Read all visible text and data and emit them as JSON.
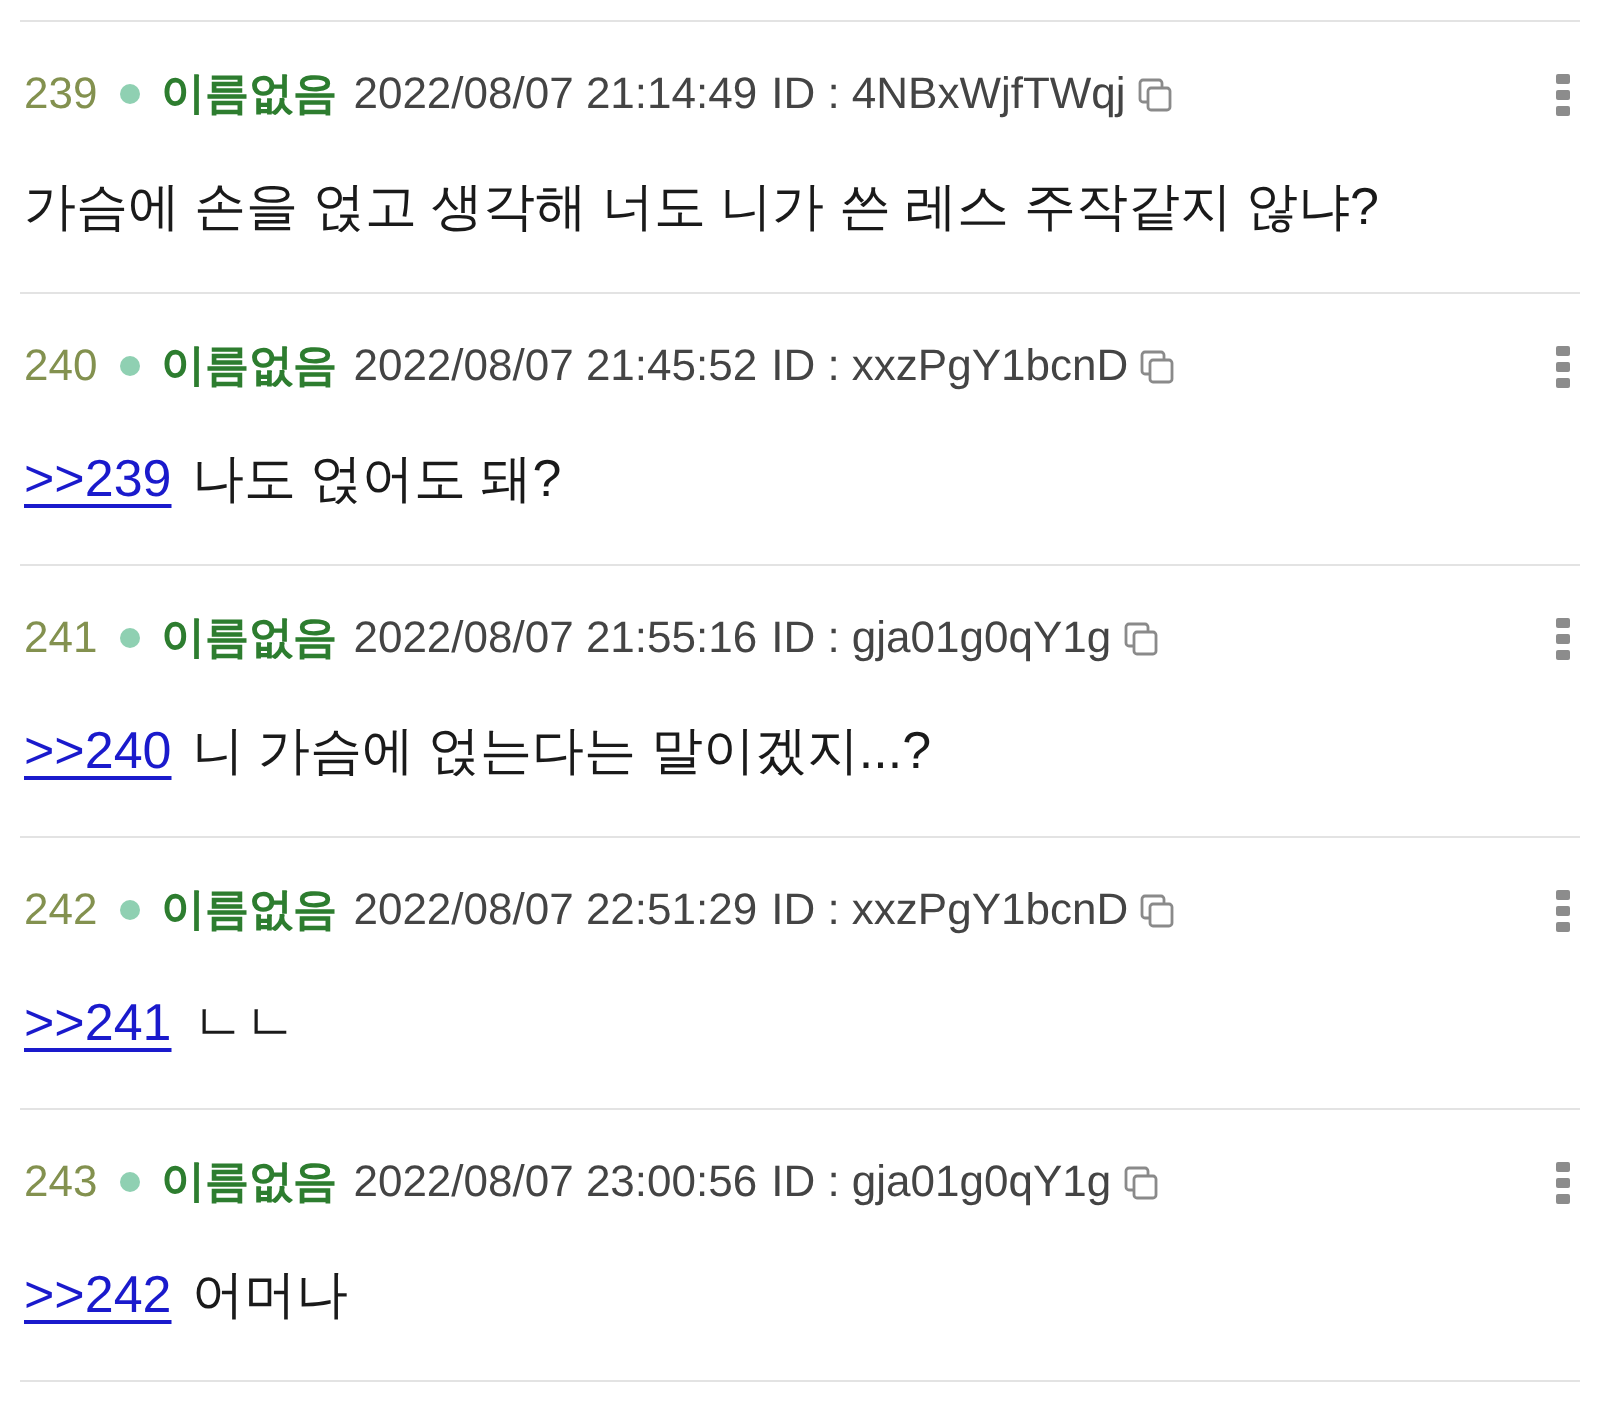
{
  "posts": [
    {
      "number": "239",
      "name": "이름없음",
      "datetime": "2022/08/07 21:14:49",
      "id": "ID : 4NBxWjfTWqj",
      "body": "가슴에 손을 얹고 생각해 너도 니가 쓴 레스 주작같지 않냐?"
    },
    {
      "number": "240",
      "name": "이름없음",
      "datetime": "2022/08/07 21:45:52",
      "id": "ID : xxzPgY1bcnD",
      "reply_link": ">>239",
      "body": "나도 얹어도 돼?"
    },
    {
      "number": "241",
      "name": "이름없음",
      "datetime": "2022/08/07 21:55:16",
      "id": "ID : gja01g0qY1g",
      "reply_link": ">>240",
      "body": "니 가슴에 얹는다는 말이겠지...?"
    },
    {
      "number": "242",
      "name": "이름없음",
      "datetime": "2022/08/07 22:51:29",
      "id": "ID : xxzPgY1bcnD",
      "reply_link": ">>241",
      "body": "ㄴㄴ"
    },
    {
      "number": "243",
      "name": "이름없음",
      "datetime": "2022/08/07 23:00:56",
      "id": "ID : gja01g0qY1g",
      "reply_link": ">>242",
      "body": "어머나"
    }
  ]
}
